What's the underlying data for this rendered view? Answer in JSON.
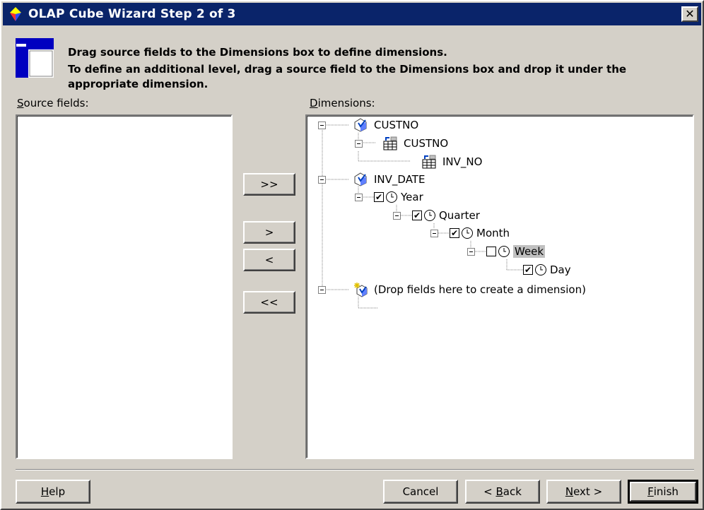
{
  "window": {
    "title": "OLAP Cube Wizard Step 2 of 3",
    "close_glyph": "✕"
  },
  "instructions": {
    "line1": "Drag source fields to the Dimensions box to define dimensions.",
    "line2": "To define an additional level, drag a source field to the Dimensions box and drop it under the appropriate dimension."
  },
  "source_fields": {
    "label_mnemonic": "S",
    "label_rest": "ource fields:",
    "items": []
  },
  "dimensions": {
    "label_mnemonic": "D",
    "label_rest": "imensions:",
    "tree": {
      "custno_dim": "CUSTNO",
      "custno_level": "CUSTNO",
      "inv_no_level": "INV_NO",
      "inv_date_dim": "INV_DATE",
      "year": "Year",
      "quarter": "Quarter",
      "month": "Month",
      "week": "Week",
      "day": "Day",
      "drop_placeholder": "(Drop fields here to create a dimension)"
    },
    "checked": {
      "year": true,
      "quarter": true,
      "month": true,
      "week": false,
      "day": true
    }
  },
  "move_buttons": {
    "add_all": ">>",
    "add": ">",
    "remove": "<",
    "remove_all": "<<"
  },
  "footer": {
    "help_mnemonic": "H",
    "help_rest": "elp",
    "cancel": "Cancel",
    "back_prefix": "< ",
    "back_mnemonic": "B",
    "back_rest": "ack",
    "next_mnemonic": "N",
    "next_rest": "ext >",
    "finish_mnemonic": "F",
    "finish_rest": "inish"
  },
  "colors": {
    "title_bar": "#0a246a",
    "face": "#d4d0c8",
    "selection": "#c0c0c0"
  }
}
